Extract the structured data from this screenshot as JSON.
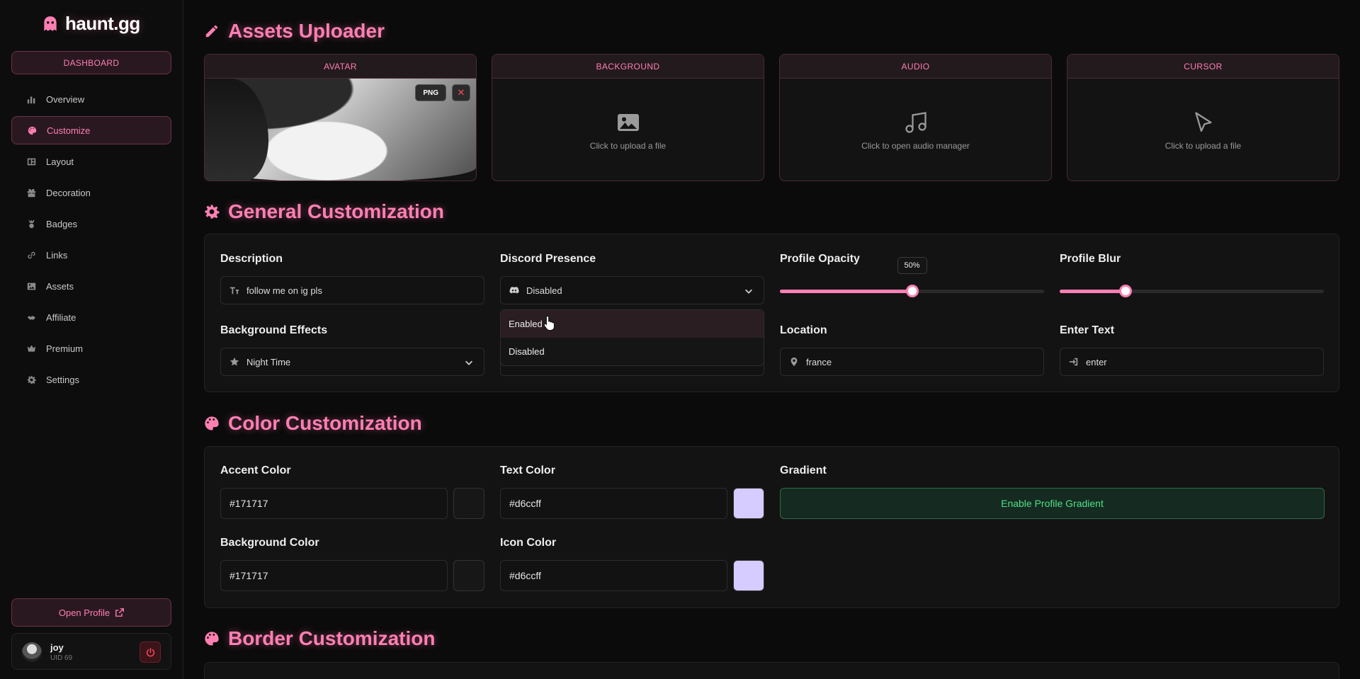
{
  "brand": {
    "name": "haunt.gg"
  },
  "sidebar": {
    "dashboard_label": "DASHBOARD",
    "items": [
      {
        "label": "Overview",
        "icon": "chart-icon"
      },
      {
        "label": "Customize",
        "icon": "palette-icon",
        "active": true
      },
      {
        "label": "Layout",
        "icon": "layout-icon"
      },
      {
        "label": "Decoration",
        "icon": "gift-icon"
      },
      {
        "label": "Badges",
        "icon": "badge-icon"
      },
      {
        "label": "Links",
        "icon": "link-icon"
      },
      {
        "label": "Assets",
        "icon": "image-icon"
      },
      {
        "label": "Affiliate",
        "icon": "affiliate-icon"
      },
      {
        "label": "Premium",
        "icon": "crown-icon"
      },
      {
        "label": "Settings",
        "icon": "gear-icon"
      }
    ],
    "open_profile_label": "Open Profile",
    "user": {
      "name": "joy",
      "uid": "UID 69"
    }
  },
  "assets": {
    "title": "Assets Uploader",
    "cards": [
      {
        "label": "AVATAR",
        "badge": "PNG",
        "remove": "✕"
      },
      {
        "label": "BACKGROUND",
        "hint": "Click to upload a file"
      },
      {
        "label": "AUDIO",
        "hint": "Click to open audio manager"
      },
      {
        "label": "CURSOR",
        "hint": "Click to upload a file"
      }
    ]
  },
  "general": {
    "title": "General Customization",
    "description": {
      "label": "Description",
      "value": "follow me on ig pls"
    },
    "discord": {
      "label": "Discord Presence",
      "value": "Disabled",
      "options": [
        "Enabled",
        "Disabled"
      ]
    },
    "opacity": {
      "label": "Profile Opacity",
      "value": 0.5,
      "tip": "50%"
    },
    "blur": {
      "label": "Profile Blur",
      "value": 0.25
    },
    "bg_effects": {
      "label": "Background Effects",
      "value": "Night Time"
    },
    "location": {
      "label": "Location",
      "value": "france"
    },
    "enter_text": {
      "label": "Enter Text",
      "value": "enter"
    }
  },
  "colors": {
    "title": "Color Customization",
    "accent": {
      "label": "Accent Color",
      "value": "#171717"
    },
    "text": {
      "label": "Text Color",
      "value": "#d6ccff"
    },
    "gradient": {
      "label": "Gradient",
      "button": "Enable Profile Gradient"
    },
    "background": {
      "label": "Background Color",
      "value": "#171717"
    },
    "icon": {
      "label": "Icon Color",
      "value": "#d6ccff"
    }
  },
  "border": {
    "title": "Border Customization"
  }
}
